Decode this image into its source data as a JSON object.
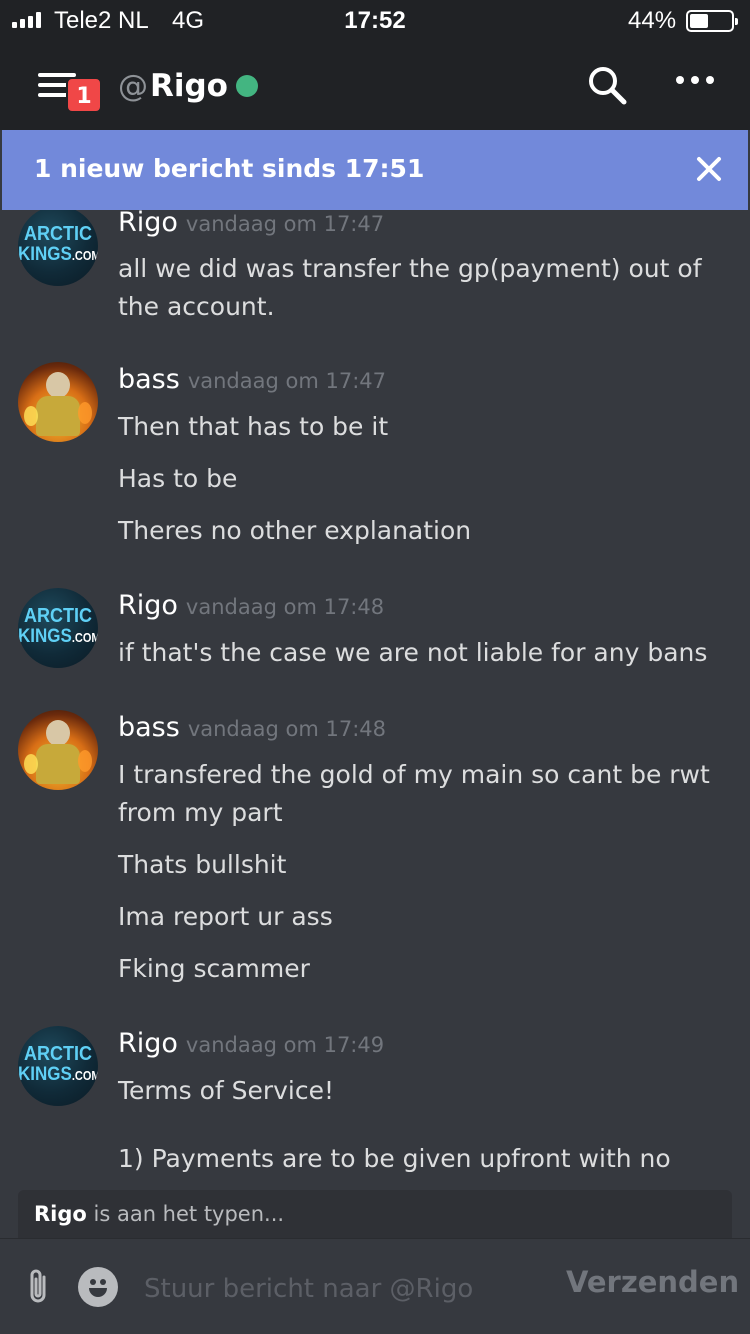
{
  "status_bar": {
    "carrier": "Tele2 NL",
    "network": "4G",
    "time": "17:52",
    "battery_percent": "44%",
    "battery_level": 0.44
  },
  "header": {
    "unread_badge": "1",
    "at_symbol": "@",
    "channel_name": "Rigo",
    "status": "online",
    "status_color": "#43b581",
    "icons": [
      "menu-icon",
      "search-icon",
      "more-icon"
    ]
  },
  "banner": {
    "text": "1 nieuw bericht sinds 17:51",
    "accent": "#7289da"
  },
  "messages": [
    {
      "author": "Rigo",
      "avatar": "arctic-kings-logo",
      "avatar_text_top": "ARCTIC",
      "avatar_text_bottom": "KINGS",
      "avatar_text_suffix": ".COM",
      "timestamp": "vandaag om 17:47",
      "lines": [
        "all we did was transfer the gp(payment) out of the account."
      ]
    },
    {
      "author": "bass",
      "avatar": "bass-avatar",
      "timestamp": "vandaag om 17:47",
      "lines": [
        "Then that has to be it",
        "Has to be",
        "Theres no other explanation"
      ]
    },
    {
      "author": "Rigo",
      "avatar": "arctic-kings-logo",
      "avatar_text_top": "ARCTIC",
      "avatar_text_bottom": "KINGS",
      "avatar_text_suffix": ".COM",
      "timestamp": "vandaag om 17:48",
      "lines": [
        "if that's the case we are not liable for any bans"
      ]
    },
    {
      "author": "bass",
      "avatar": "bass-avatar",
      "timestamp": "vandaag om 17:48",
      "lines": [
        "I transfered the gold of my main so cant be rwt from my part",
        "Thats bullshit",
        "Ima report ur ass",
        "Fking scammer"
      ]
    },
    {
      "author": "Rigo",
      "avatar": "arctic-kings-logo",
      "avatar_text_top": "ARCTIC",
      "avatar_text_bottom": "KINGS",
      "avatar_text_suffix": ".COM",
      "timestamp": "vandaag om 17:49",
      "lines": [
        "Terms of Service!",
        "1) Payments are to be given upfront with no"
      ]
    }
  ],
  "typing": {
    "user": "Rigo",
    "text": " is aan het typen..."
  },
  "composer": {
    "placeholder": "Stuur bericht naar @Rigo",
    "value": "",
    "send_label": "Verzenden"
  }
}
